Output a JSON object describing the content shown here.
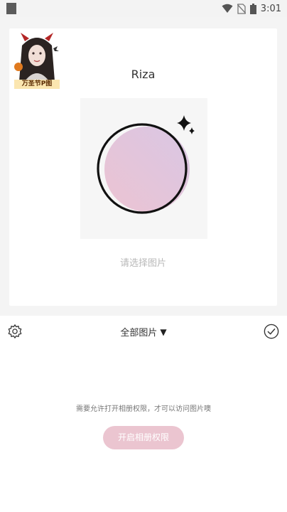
{
  "status_bar": {
    "time": "3:01",
    "icons": [
      "wifi-icon",
      "no-sim-icon",
      "battery-icon"
    ]
  },
  "profile": {
    "avatar_caption": "万圣节P图",
    "name": "Riza"
  },
  "preview": {
    "hint": "请选择图片"
  },
  "toolbar": {
    "album_label": "全部图片",
    "caret": "▼"
  },
  "permission": {
    "message": "需要允许打开相册权限，才可以访问图片噢",
    "button_label": "开启相册权限"
  },
  "colors": {
    "button_bg": "#ebc5d0",
    "preview_gradient_start": "#ecc4d2",
    "preview_gradient_end": "#d9c6e4"
  }
}
